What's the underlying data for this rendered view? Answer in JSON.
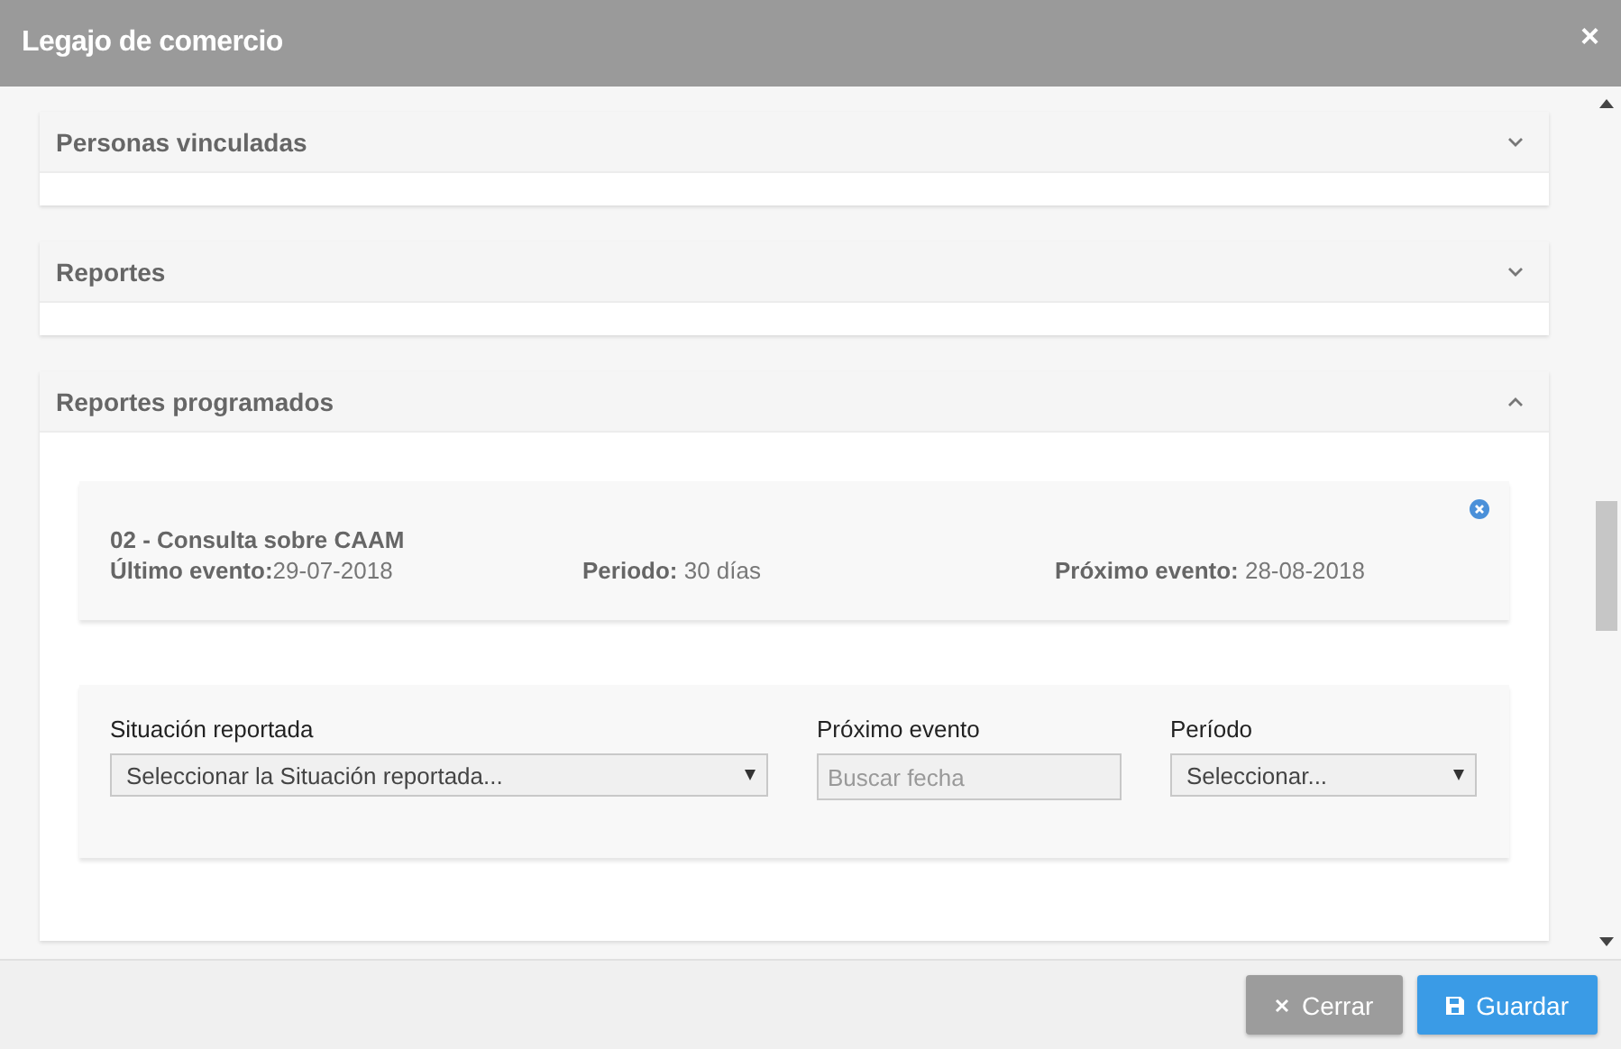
{
  "window": {
    "title": "Legajo de comercio",
    "close": "×"
  },
  "sections": [
    {
      "title": "Personas vinculadas",
      "expanded": false
    },
    {
      "title": "Reportes",
      "expanded": false
    },
    {
      "title": "Reportes programados",
      "expanded": true,
      "report": {
        "name": "02 - Consulta sobre CAAM",
        "details": [
          "**Último evento:**29-07-2018",
          "**Periodo:** 30 días",
          "**Próximo evento:** 28-08-2018"
        ]
      },
      "form": [
        {
          "kind": "select",
          "label": "Situación reportada",
          "placeholder": "Seleccionar la Situación reportada..."
        },
        {
          "kind": "date",
          "label": "Próximo evento",
          "placeholder": "Buscar fecha"
        },
        {
          "kind": "select",
          "label": "Período",
          "placeholder": "Seleccionar..."
        }
      ]
    }
  ],
  "buttons": [
    {
      "kind": "cancel",
      "label": "Cerrar"
    },
    {
      "kind": "save",
      "label": "Guardar"
    }
  ]
}
